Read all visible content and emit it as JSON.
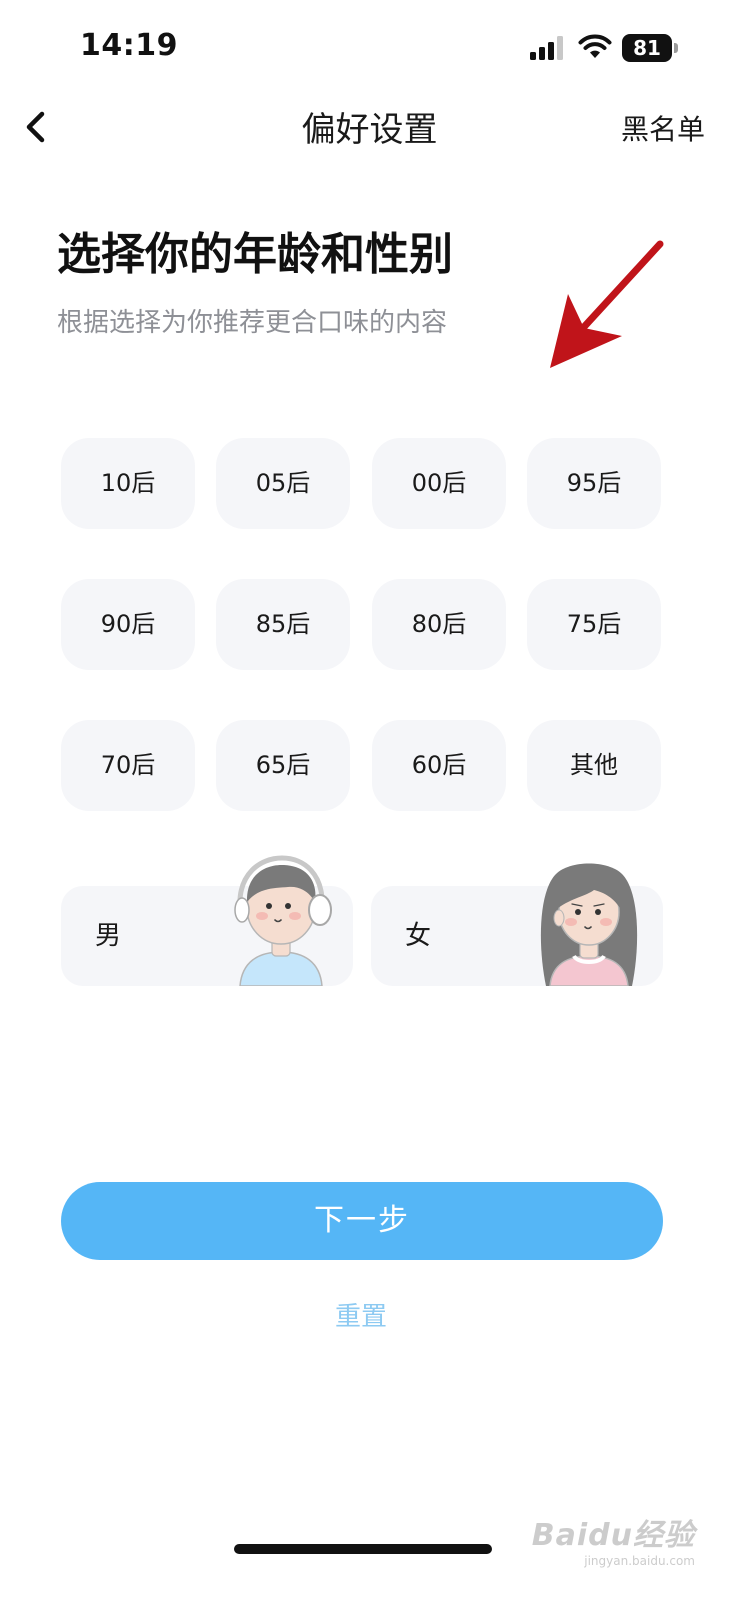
{
  "status_bar": {
    "time": "14:19",
    "battery": "81"
  },
  "nav": {
    "title": "偏好设置",
    "blacklist_label": "黑名单",
    "back_icon": "chevron-left-icon"
  },
  "heading": {
    "title": "选择你的年龄和性别",
    "subtitle": "根据选择为你推荐更合口味的内容"
  },
  "age_options": [
    "10后",
    "05后",
    "00后",
    "95后",
    "90后",
    "85后",
    "80后",
    "75后",
    "70后",
    "65后",
    "60后",
    "其他"
  ],
  "gender_options": {
    "male": "男",
    "female": "女"
  },
  "actions": {
    "next_label": "下一步",
    "reset_label": "重置"
  },
  "watermark": {
    "logo": "Baidu经验",
    "url": "jingyan.baidu.com"
  },
  "colors": {
    "primary": "#55b6f6",
    "reset_text": "#8dcaf2",
    "chip_bg": "#f5f6f9",
    "annotation_arrow": "#c0141a",
    "subtitle_text": "#8e9096"
  }
}
